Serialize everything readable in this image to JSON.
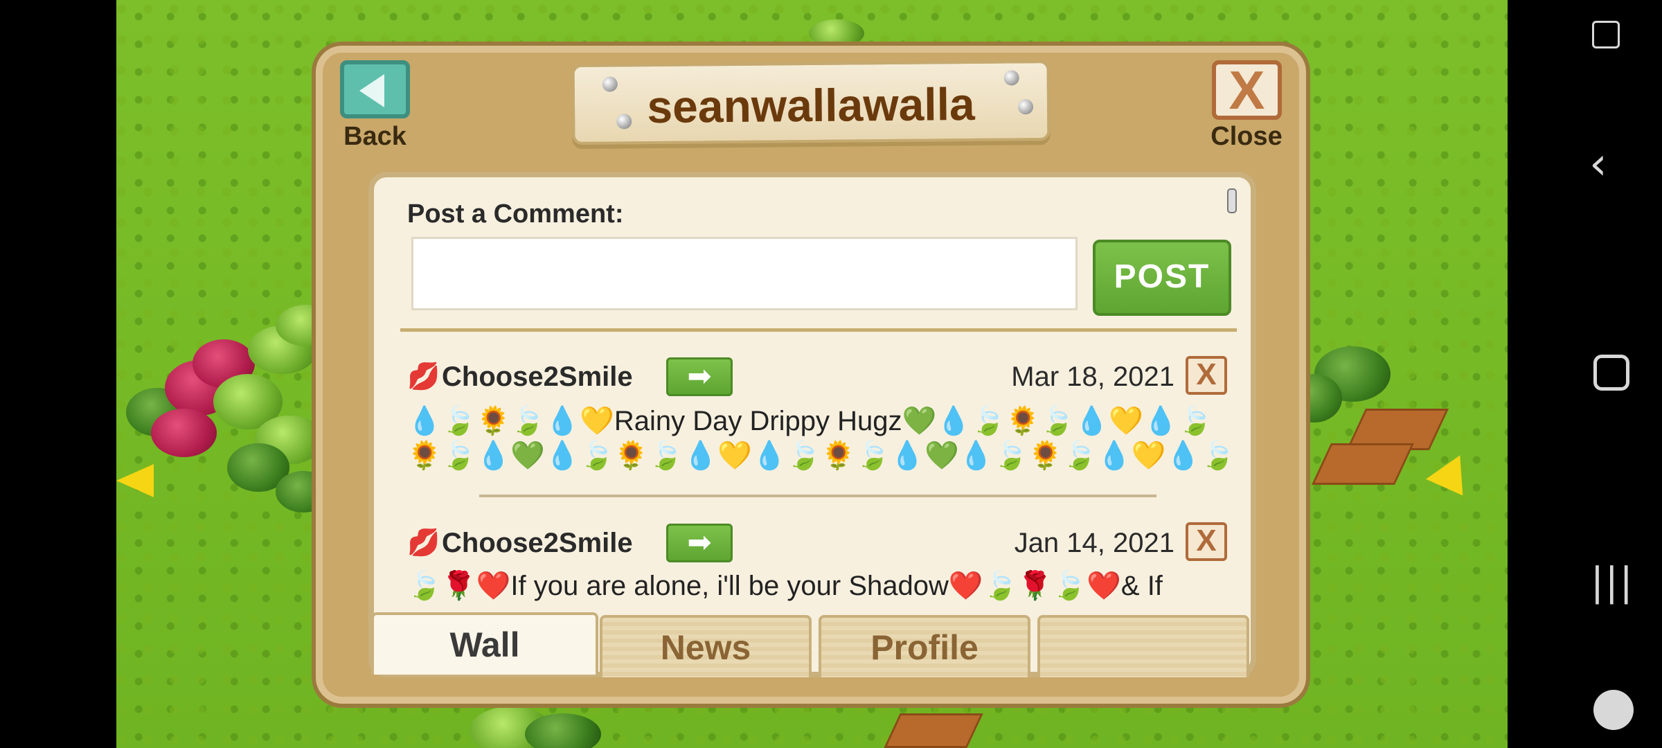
{
  "dialog": {
    "title": "seanwallawalla",
    "back_label": "Back",
    "close_label": "Close",
    "close_glyph": "X"
  },
  "comment": {
    "label": "Post a Comment:",
    "input_value": "",
    "input_placeholder": "",
    "post_label": "POST"
  },
  "wall": {
    "entries": [
      {
        "author": "Choose2Smile",
        "date": "Mar 18, 2021",
        "line1": "💧🍃🌻🍃💧💛Rainy Day Drippy Hugz💚💧🍃🌻🍃💧💛💧🍃",
        "line2": "🌻🍃💧💚💧🍃🌻🍃💧💛💧🍃🌻🍃💧💚💧🍃🌻🍃💧💛💧🍃"
      },
      {
        "author": "Choose2Smile",
        "date": "Jan 14, 2021",
        "line1": "🍃🌹❤️If you are alone, i'll be your Shadow❤️🍃🌹🍃❤️& If"
      }
    ]
  },
  "tabs": [
    "Wall",
    "News",
    "Profile",
    ""
  ],
  "active_tab": "Wall",
  "icons": {
    "lips": "💋",
    "arrow": "➡",
    "delete": "X"
  },
  "colors": {
    "post_green": "#5ea532",
    "back_teal": "#5fbfad",
    "close_brown": "#b06b3a",
    "title_brown": "#6b3a0c"
  }
}
